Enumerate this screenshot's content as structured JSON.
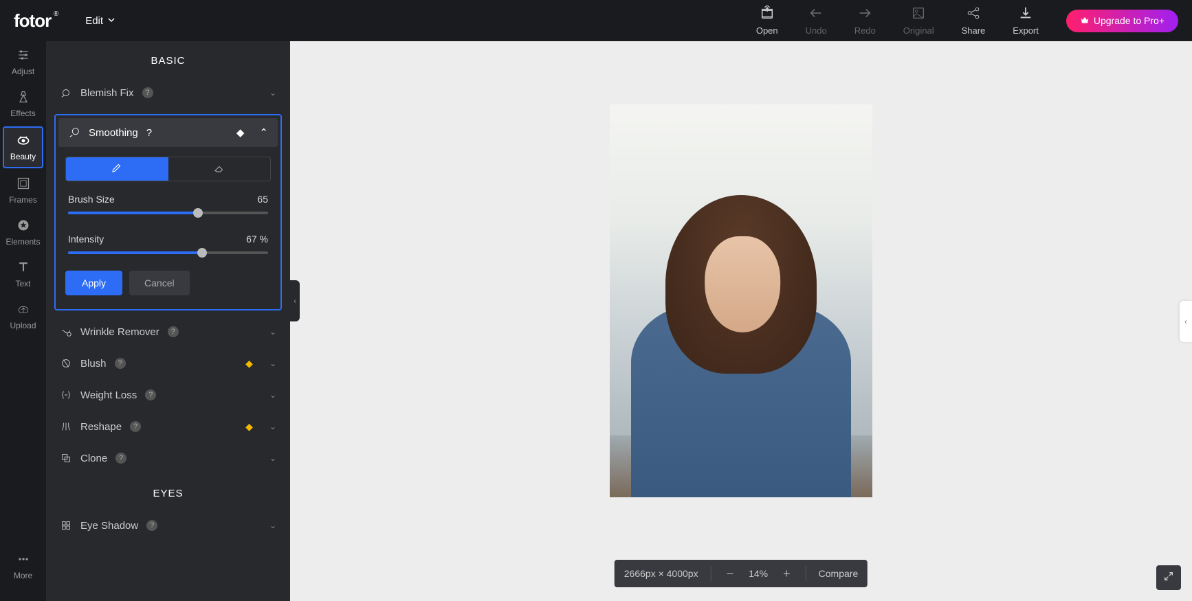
{
  "top": {
    "logo": "fotor",
    "edit": "Edit",
    "open": "Open",
    "undo": "Undo",
    "redo": "Redo",
    "original": "Original",
    "share": "Share",
    "export": "Export",
    "upgrade": "Upgrade to Pro+"
  },
  "nav": {
    "adjust": "Adjust",
    "effects": "Effects",
    "beauty": "Beauty",
    "frames": "Frames",
    "elements": "Elements",
    "text": "Text",
    "upload": "Upload",
    "more": "More"
  },
  "panel": {
    "basic": "BASIC",
    "eyes": "EYES",
    "blemish": "Blemish Fix",
    "smoothing": "Smoothing",
    "wrinkle": "Wrinkle Remover",
    "blush": "Blush",
    "weight": "Weight Loss",
    "reshape": "Reshape",
    "clone": "Clone",
    "eyeshadow": "Eye Shadow",
    "brushSizeLabel": "Brush Size",
    "brushSizeValue": "65",
    "intensityLabel": "Intensity",
    "intensityValue": "67",
    "intensityUnit": "%",
    "apply": "Apply",
    "cancel": "Cancel"
  },
  "status": {
    "dimensions": "2666px × 4000px",
    "zoom": "14%",
    "compare": "Compare"
  }
}
